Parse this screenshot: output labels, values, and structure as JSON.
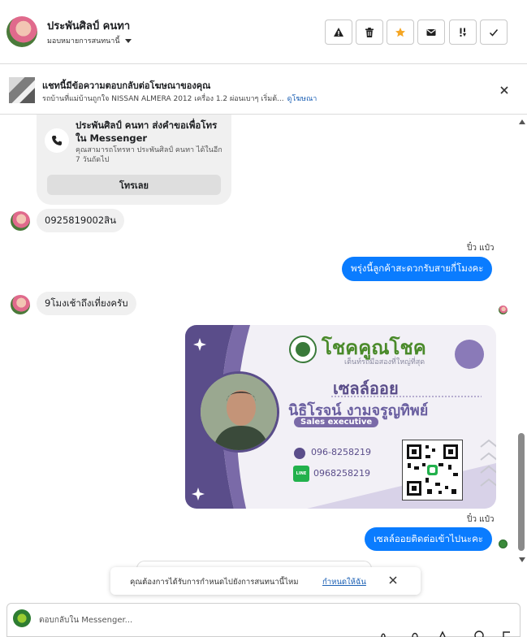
{
  "header": {
    "contact_name": "ประพันศิลป์ คนทา",
    "assign_label": "มอบหมายการสนทนานี้",
    "actions": [
      "report",
      "delete",
      "star",
      "mark-unread",
      "spam",
      "done"
    ]
  },
  "ad_banner": {
    "title": "แชทนี้มีข้อความตอบกลับต่อโฆษณาของคุณ",
    "subtitle": "รถบ้านที่แม่บ้านถูกใจ NISSAN ALMERA 2012 เครื่อง 1.2 ผ่อนเบาๆ เริ่มต้...",
    "link": "ดูโฆษณา"
  },
  "call_card": {
    "title": "ประพันศิลป์ คนทา ส่งคำขอเพื่อโทรใน Messenger",
    "subtitle": "คุณสามารถโทรหา ประพันศิลป์ คนทา ได้ในอีก 7 วันถัดไป",
    "button": "โทรเลย"
  },
  "messages": [
    {
      "direction": "in",
      "text": "0925819002สิน"
    },
    {
      "direction": "out",
      "sender": "ปิ๋ว แป๋ว",
      "text": "พรุ่งนี้ลูกค้าสะดวกรับสายกี่โมงคะ"
    },
    {
      "direction": "in",
      "text": "9โมงเช้าถึงเที่ยงครับ"
    },
    {
      "direction": "out",
      "sender": "ปิ๋ว แป๋ว",
      "text": "เซลล์ออยติดต่อเข้าไปนะคะ"
    }
  ],
  "business_card": {
    "brand": "โชคคูณโชค",
    "tagline": "เต็นท์รถมือสองที่ใหญ่ที่สุด",
    "role": "เซลล์ออย",
    "name": "นิธิโรจน์  งามจรูญทิพย์",
    "title": "Sales executive",
    "phone": "096-8258219",
    "line_label": "LINE",
    "line": "0968258219"
  },
  "toast": {
    "text": "คุณต้องการได้รับการกำหนดไปยังการสนทนานี้ไหม",
    "link": "กำหนดให้ฉัน"
  },
  "composer": {
    "placeholder": "ตอบกลับใน Messenger..."
  },
  "colors": {
    "accent": "#0a7cff",
    "bubble_in": "#f0f0f0",
    "card_purple": "#5a4d8a",
    "star": "#f5a623"
  }
}
